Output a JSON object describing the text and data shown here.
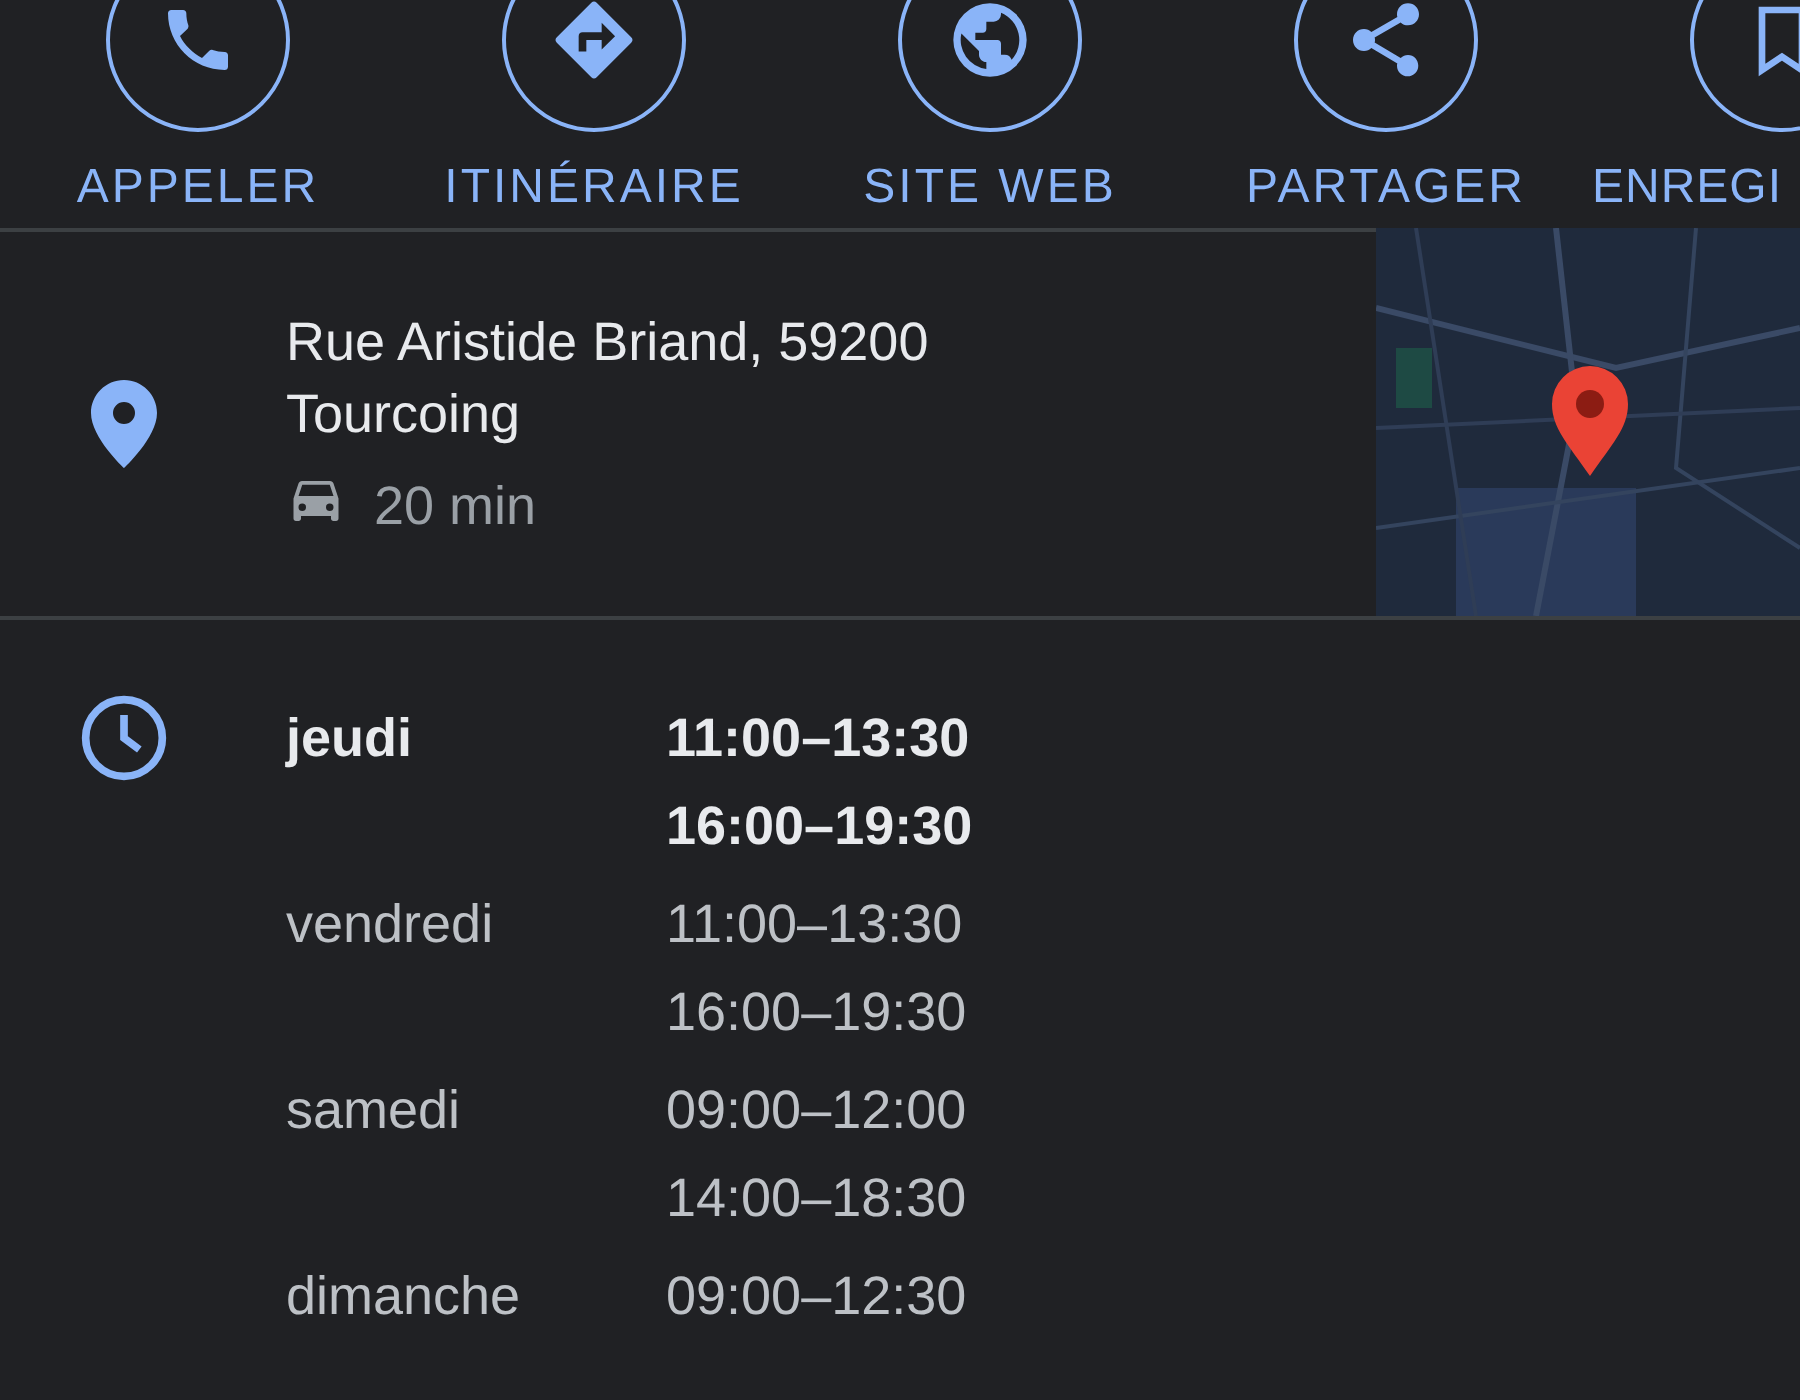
{
  "actions": [
    {
      "kind": "call",
      "label": "APPELER"
    },
    {
      "kind": "directions",
      "label": "ITINÉRAIRE"
    },
    {
      "kind": "website",
      "label": "SITE WEB"
    },
    {
      "kind": "share",
      "label": "PARTAGER"
    },
    {
      "kind": "save",
      "label": "ENREGI"
    }
  ],
  "address": {
    "lines": [
      "Rue Aristide Briand, 59200",
      "Tourcoing"
    ],
    "travel_time": "20 min"
  },
  "hours": [
    {
      "day": "jeudi",
      "today": true,
      "ranges": [
        "11:00–13:30",
        "16:00–19:30"
      ]
    },
    {
      "day": "vendredi",
      "today": false,
      "ranges": [
        "11:00–13:30",
        "16:00–19:30"
      ]
    },
    {
      "day": "samedi",
      "today": false,
      "ranges": [
        "09:00–12:00",
        "14:00–18:30"
      ]
    },
    {
      "day": "dimanche",
      "today": false,
      "ranges": [
        "09:00–12:30"
      ]
    }
  ]
}
